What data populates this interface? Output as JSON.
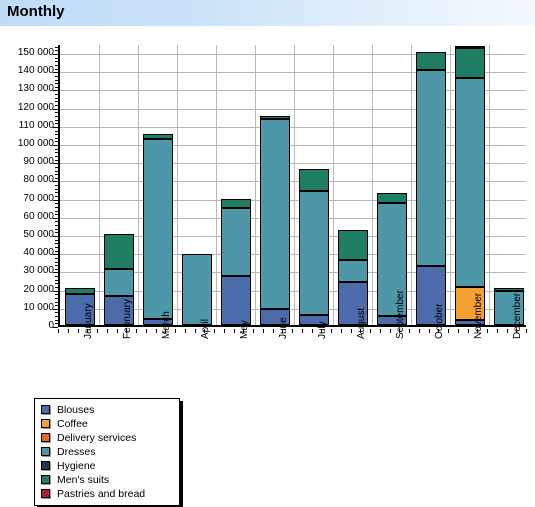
{
  "header": {
    "title": "Monthly"
  },
  "chart_data": {
    "type": "bar",
    "subtype": "stacked-bar",
    "title": "Monthly",
    "xlabel": "",
    "ylabel": "",
    "ylim": [
      0,
      155000
    ],
    "grid": true,
    "legend_position": "bottom-left",
    "ytick_labels": [
      "150 000",
      "140 000",
      "130 000",
      "120 000",
      "110 000",
      "100 000",
      "90 000",
      "80 000",
      "70 000",
      "60 000",
      "50 000",
      "40 000",
      "30 000",
      "20 000",
      "10 000",
      "0"
    ],
    "ytick_values": [
      150000,
      140000,
      130000,
      120000,
      110000,
      100000,
      90000,
      80000,
      70000,
      60000,
      50000,
      40000,
      30000,
      20000,
      10000,
      0
    ],
    "categories": [
      "January",
      "February",
      "March",
      "April",
      "May",
      "June",
      "July",
      "August",
      "September",
      "October",
      "November",
      "December"
    ],
    "series": [
      {
        "name": "Blouses",
        "color": "#4b6bab",
        "values": [
          17000,
          16000,
          3500,
          0,
          27000,
          9000,
          5500,
          23500,
          5000,
          32500,
          2500,
          0
        ]
      },
      {
        "name": "Coffee",
        "color": "#f5a033",
        "values": [
          0,
          0,
          0,
          0,
          0,
          0,
          0,
          0,
          0,
          0,
          18500,
          0
        ]
      },
      {
        "name": "Delivery services",
        "color": "#ed6720",
        "values": [
          0,
          0,
          0,
          0,
          0,
          0,
          0,
          0,
          0,
          0,
          0,
          0
        ]
      },
      {
        "name": "Dresses",
        "color": "#4d97a8",
        "values": [
          0,
          15000,
          98500,
          39000,
          37500,
          104000,
          68000,
          12000,
          62000,
          107500,
          115000,
          18500
        ]
      },
      {
        "name": "Hygiene",
        "color": "#23355c",
        "values": [
          0,
          0,
          0,
          0,
          0,
          0,
          0,
          0,
          0,
          0,
          0,
          0
        ]
      },
      {
        "name": "Men's suits",
        "color": "#1e7d63",
        "values": [
          3500,
          19000,
          3000,
          0,
          4500,
          2000,
          12500,
          16500,
          5500,
          10000,
          16500,
          2000
        ]
      },
      {
        "name": "Pastries and bread",
        "color": "#b71b25",
        "values": [
          0,
          0,
          0,
          0,
          0,
          0,
          0,
          0,
          0,
          0,
          1000,
          0
        ]
      }
    ],
    "totals": [
      20500,
      50000,
      105000,
      39000,
      69000,
      115000,
      86000,
      52000,
      72500,
      150000,
      153500,
      20500
    ]
  },
  "legend": {
    "items": [
      {
        "label": "Blouses",
        "color": "#4b6bab"
      },
      {
        "label": "Coffee",
        "color": "#f5a033"
      },
      {
        "label": "Delivery services",
        "color": "#ed6720"
      },
      {
        "label": "Dresses",
        "color": "#4d97a8"
      },
      {
        "label": "Hygiene",
        "color": "#23355c"
      },
      {
        "label": "Men's suits",
        "color": "#1e7d63"
      },
      {
        "label": "Pastries and bread",
        "color": "#b71b25"
      }
    ]
  }
}
